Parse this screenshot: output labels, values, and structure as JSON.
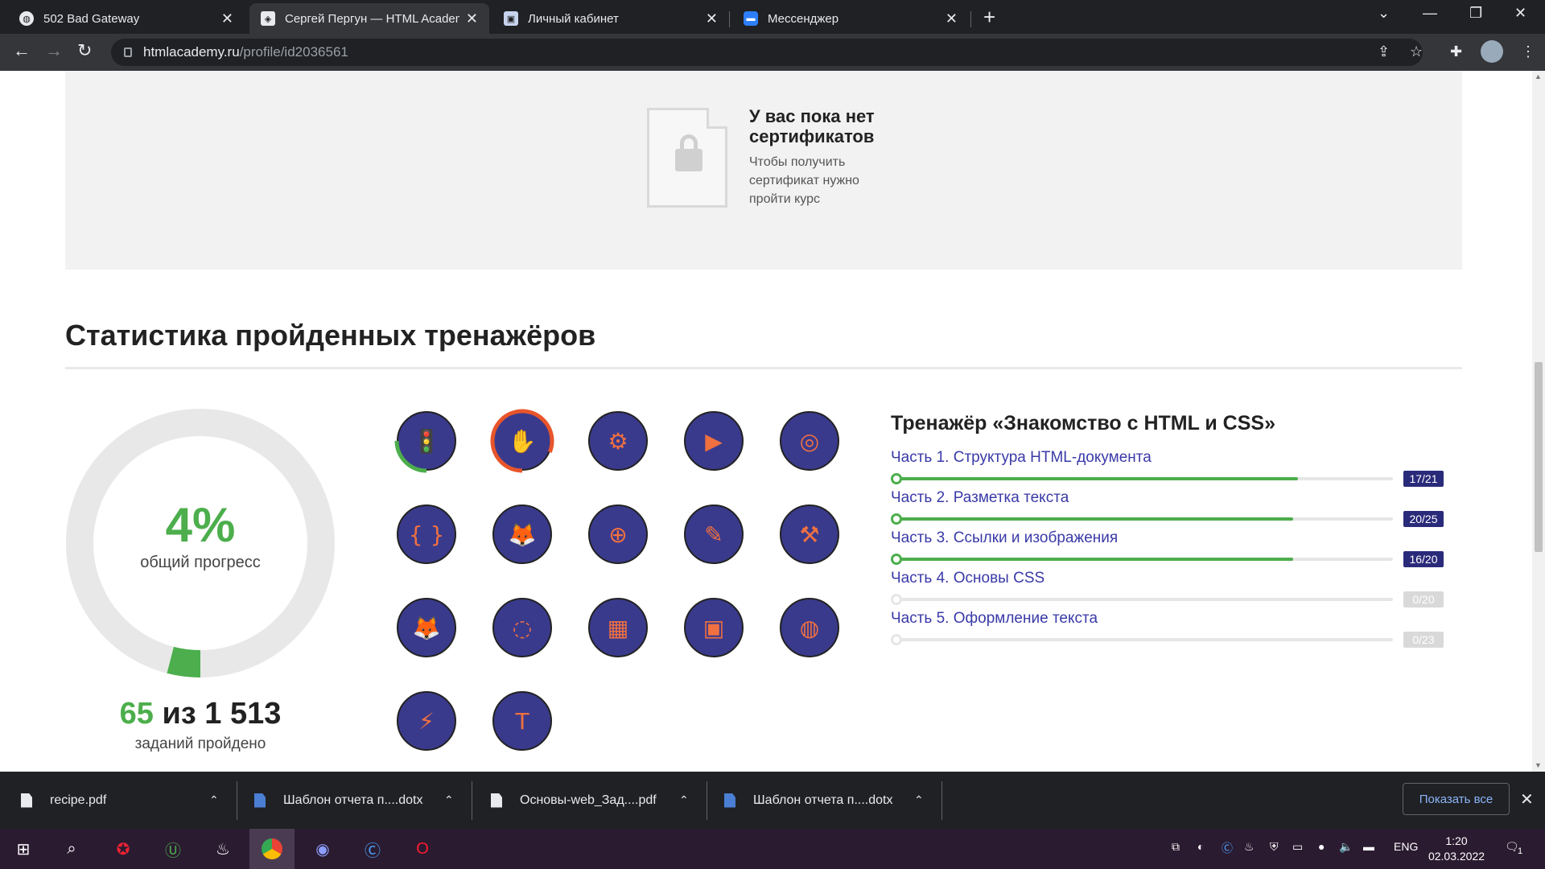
{
  "browser": {
    "tabs": [
      {
        "title": "502 Bad Gateway",
        "icon": "globe-icon"
      },
      {
        "title": "Сергей Пергун — HTML Academy",
        "icon": "htmlacademy-icon"
      },
      {
        "title": "Личный кабинет",
        "icon": "portal-icon"
      },
      {
        "title": "Мессенджер",
        "icon": "messenger-icon"
      }
    ],
    "url_host": "htmlacademy.ru",
    "url_path": "/profile/id2036561"
  },
  "certificates": {
    "title": "У вас пока нет сертификатов",
    "text": "Чтобы получить сертификат нужно пройти курс"
  },
  "stats": {
    "heading": "Статистика пройденных тренажёров",
    "percent": "4%",
    "percent_value": 0.04,
    "percent_label": "общий прогресс",
    "done": "65",
    "of": "из",
    "total": "1 513",
    "count_label": "заданий пройдено"
  },
  "badges": [
    {
      "icon": "traffic-light-icon",
      "progress": 0.25
    },
    {
      "icon": "hand-icon",
      "progress": 0.81
    },
    {
      "icon": "spinning-top-icon",
      "progress": 0
    },
    {
      "icon": "php-clapperboard-icon",
      "progress": 0
    },
    {
      "icon": "submarine-icon",
      "progress": 0
    },
    {
      "icon": "curly-braces-icon",
      "progress": 0
    },
    {
      "icon": "fox-icon",
      "progress": 0
    },
    {
      "icon": "football-field-icon",
      "progress": 0
    },
    {
      "icon": "paintbrush-icon",
      "progress": 0
    },
    {
      "icon": "anvil-icon",
      "progress": 0
    },
    {
      "icon": "fox-wine-icon",
      "progress": 0
    },
    {
      "icon": "bezier-circle-icon",
      "progress": 0
    },
    {
      "icon": "cube-icon",
      "progress": 0
    },
    {
      "icon": "remote-control-icon",
      "progress": 0
    },
    {
      "icon": "orbit-icon",
      "progress": 0
    },
    {
      "icon": "chainsaw-icon",
      "progress": 0
    },
    {
      "icon": "typography-icon",
      "progress": 0
    }
  ],
  "trainer": {
    "title": "Тренажёр «Знакомство с HTML и CSS»",
    "parts": [
      {
        "name": "Часть 1. Структура HTML-документа",
        "score": "17/21",
        "progress": 0.81
      },
      {
        "name": "Часть 2. Разметка текста",
        "score": "20/25",
        "progress": 0.8
      },
      {
        "name": "Часть 3. Ссылки и изображения",
        "score": "16/20",
        "progress": 0.8
      },
      {
        "name": "Часть 4. Основы CSS",
        "score": "0/20",
        "progress": 0
      },
      {
        "name": "Часть 5. Оформление текста",
        "score": "0/23",
        "progress": 0
      }
    ]
  },
  "downloads": {
    "items": [
      {
        "name": "recipe.pdf",
        "type": "pdf"
      },
      {
        "name": "Шаблон отчета п....dotx",
        "type": "word"
      },
      {
        "name": "Основы-web_Зад....pdf",
        "type": "pdf"
      },
      {
        "name": "Шаблон отчета п....dotx",
        "type": "word"
      }
    ],
    "show_all": "Показать все"
  },
  "taskbar": {
    "lang": "ENG",
    "time": "1:20",
    "date": "02.03.2022",
    "notifications": "1"
  },
  "colors": {
    "accent_green": "#4cae4c",
    "badge_purple": "#3a3a8c",
    "orange": "#e8552b"
  }
}
